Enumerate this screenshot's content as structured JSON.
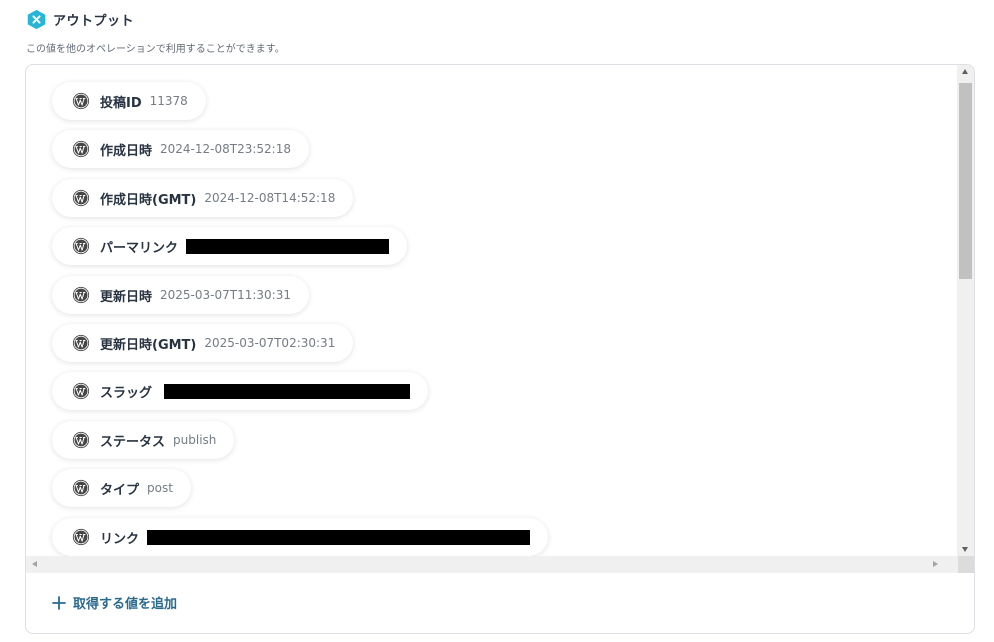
{
  "header": {
    "title": "アウトプット",
    "subtitle": "この値を他のオペレーションで利用することができます。",
    "brand_color": "#29b6d6"
  },
  "outputs": [
    {
      "label": "投稿ID",
      "value": "11378",
      "redacted": false
    },
    {
      "label": "作成日時",
      "value": "2024-12-08T23:52:18",
      "redacted": false
    },
    {
      "label": "作成日時(GMT)",
      "value": "2024-12-08T14:52:18",
      "redacted": false
    },
    {
      "label": "パーマリンク",
      "value": "",
      "redacted": true
    },
    {
      "label": "更新日時",
      "value": "2025-03-07T11:30:31",
      "redacted": false
    },
    {
      "label": "更新日時(GMT)",
      "value": "2025-03-07T02:30:31",
      "redacted": false
    },
    {
      "label": "スラッグ",
      "value": "",
      "redacted": true
    },
    {
      "label": "ステータス",
      "value": "publish",
      "redacted": false
    },
    {
      "label": "タイプ",
      "value": "post",
      "redacted": false
    },
    {
      "label": "リンク",
      "value": "",
      "redacted": true
    }
  ],
  "item_icon": "wordpress-icon",
  "add_button": {
    "label": "取得する値を追加",
    "icon": "plus-icon",
    "color": "#2a6a8d"
  }
}
